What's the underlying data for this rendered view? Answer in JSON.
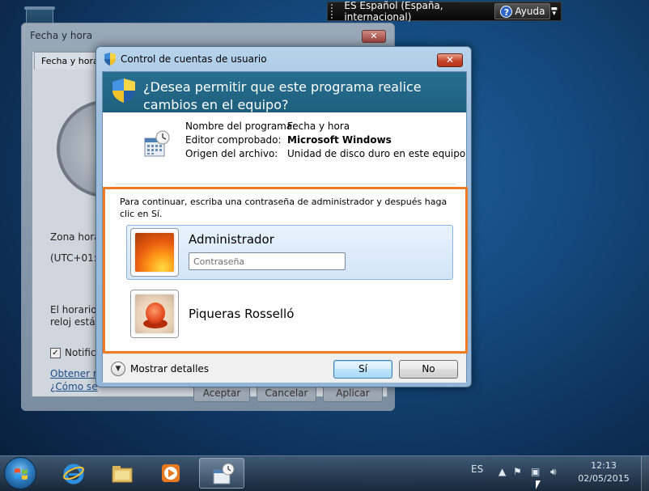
{
  "language_bar": {
    "language": "ES Español (España, internacional)",
    "help_label": "Ayuda",
    "help_icon": "question-circle-icon",
    "menu_icon": "options-chevron-icon"
  },
  "background_window": {
    "title": "Fecha y hora",
    "close_icon": "close-icon",
    "tab_label": "Fecha y hora",
    "timezone_label": "Zona horar",
    "timezone_value": "(UTC+01:0",
    "dst_text_1": "El horario d",
    "dst_text_2": "reloj está c",
    "notify_label": "Notifica",
    "link_1": "Obtener m",
    "link_2": "¿Cómo se",
    "buttons": [
      "Aceptar",
      "Cancelar",
      "Aplicar"
    ]
  },
  "uac": {
    "title": "Control de cuentas de usuario",
    "title_icon": "uac-shield-icon",
    "close_icon": "close-icon",
    "question": "¿Desea permitir que este programa realice cambios en el equipo?",
    "program_icon": "calendar-clock-icon",
    "info": [
      {
        "key": "Nombre del programa:",
        "value": "Fecha y hora",
        "bold": false
      },
      {
        "key": "Editor comprobado:",
        "value": "Microsoft Windows",
        "bold": true
      },
      {
        "key": "Origen del archivo:",
        "value": "Unidad de disco duro en este equipo",
        "bold": false
      }
    ],
    "prompt": "Para continuar, escriba una contraseña de administrador y después haga clic en Sí.",
    "accounts": [
      {
        "name": "Administrador",
        "picture": "orange-flower",
        "selected": true,
        "password_placeholder": "Contraseña"
      },
      {
        "name": "Piqueras Rosselló",
        "picture": "orange-robot",
        "selected": false
      }
    ],
    "details_label": "Mostrar detalles",
    "details_icon": "chevron-down-icon",
    "yes_label": "Sí",
    "no_label": "No",
    "highlight_color": "#ef7b23"
  },
  "taskbar": {
    "start_icon": "windows-start-icon",
    "pinned": [
      "internet-explorer-icon",
      "file-explorer-icon",
      "media-player-icon",
      "date-time-icon"
    ],
    "active_item": "date-time-icon",
    "tray_language": "ES",
    "tray_icons": [
      "show-hidden-icons-icon",
      "action-center-icon",
      "network-icon",
      "volume-icon"
    ],
    "time": "12:13",
    "date": "02/05/2015"
  }
}
